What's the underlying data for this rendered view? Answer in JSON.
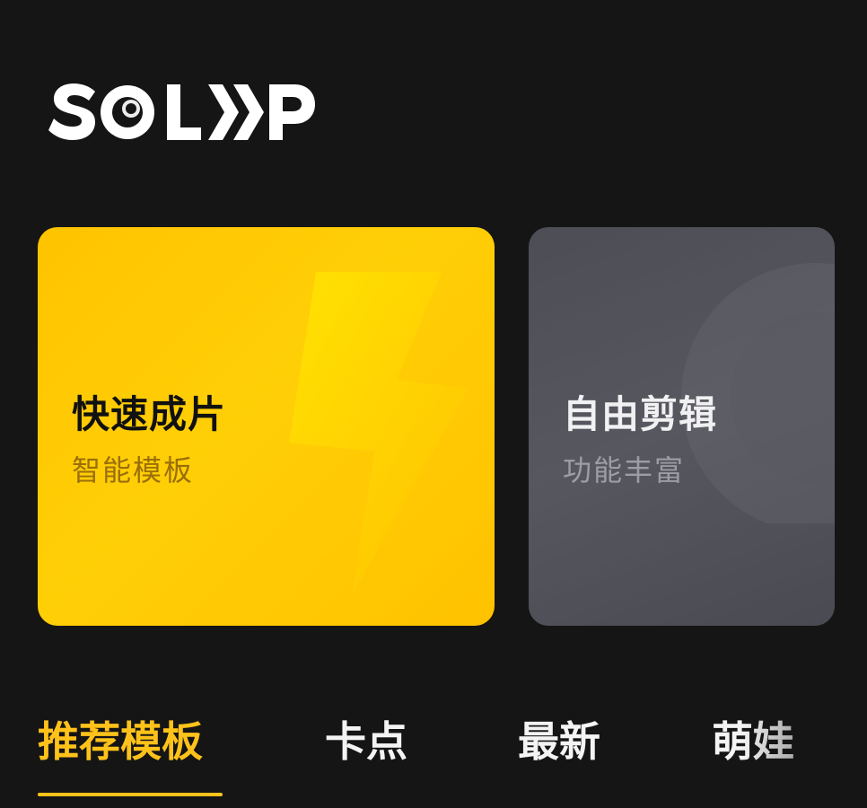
{
  "app": {
    "logo_text": "SOLOOP"
  },
  "cards": [
    {
      "title": "快速成片",
      "subtitle": "智能模板"
    },
    {
      "title": "自由剪辑",
      "subtitle": "功能丰富"
    }
  ],
  "tabs": [
    {
      "label": "推荐模板",
      "active": true
    },
    {
      "label": "卡点",
      "active": false
    },
    {
      "label": "最新",
      "active": false
    },
    {
      "label": "萌娃",
      "active": false
    }
  ],
  "colors": {
    "background": "#151515",
    "accent": "#ffc21a",
    "quick_card": "#ffc600",
    "free_card": "#505058"
  }
}
